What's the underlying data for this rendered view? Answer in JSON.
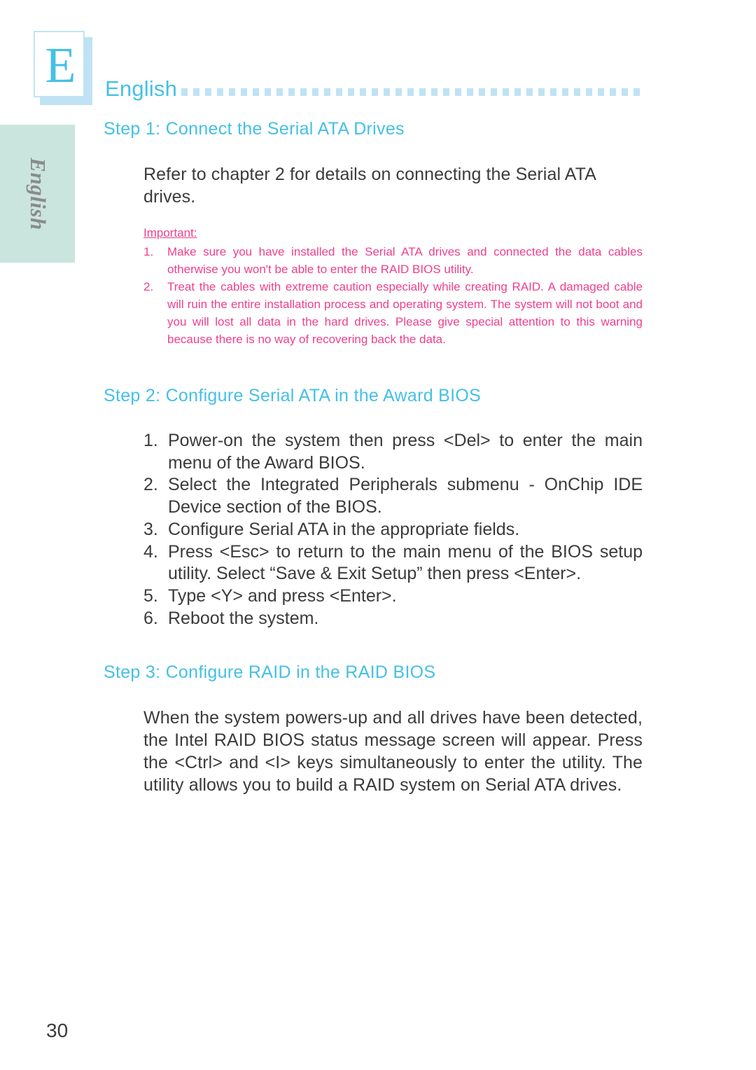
{
  "logo": {
    "letter": "E"
  },
  "running_head": {
    "label": "English",
    "dots_icon": "square-dot-rule"
  },
  "side_tab": {
    "label": "English"
  },
  "colors": {
    "heading_cyan": "#45c0e6",
    "note_magenta": "#ef3f8d",
    "tab_sage": "#c9e5de",
    "dot_blue": "#bfe3f4",
    "body_gray": "#3b3b3b"
  },
  "steps": [
    {
      "heading": "Step 1: Connect the Serial ATA Drives",
      "paragraph": "Refer to chapter 2 for details on connecting the Serial ATA drives."
    },
    {
      "heading": "Step 2: Configure Serial ATA in the Award BIOS"
    },
    {
      "heading": "Step 3: Configure RAID in the RAID BIOS",
      "paragraph": "When the system powers-up and all drives have been detected, the Intel RAID BIOS status message screen will appear. Press the <Ctrl> and <I> keys simultaneously to enter the utility. The utility allows you to build a RAID system on Serial ATA drives."
    }
  ],
  "important_note": {
    "title": "Important:",
    "items": [
      {
        "number": "1.",
        "text": "Make sure you have installed the Serial ATA drives and connected the data cables otherwise you won't be able to enter the RAID BIOS utility."
      },
      {
        "number": "2.",
        "text": "Treat the cables with extreme caution especially while creating RAID. A damaged cable will ruin the entire installation process and operating system. The system will not boot and you will lost all data in the hard drives. Please give special attention to this warning because there is no way of recovering back the data."
      }
    ]
  },
  "award_bios_steps": [
    {
      "number": "1.",
      "text": "Power-on the system then press <Del> to enter the main menu of the Award BIOS."
    },
    {
      "number": "2.",
      "text": "Select the Integrated Peripherals submenu - OnChip IDE Device section of the BIOS."
    },
    {
      "number": "3.",
      "text": "Configure Serial ATA in the appropriate fields."
    },
    {
      "number": "4.",
      "text": "Press <Esc> to return to the main menu of the BIOS setup utility. Select “Save & Exit Setup” then press <Enter>."
    },
    {
      "number": "5.",
      "text": "Type <Y> and press <Enter>."
    },
    {
      "number": "6.",
      "text": "Reboot the system."
    }
  ],
  "folio": {
    "page_number": "30"
  }
}
